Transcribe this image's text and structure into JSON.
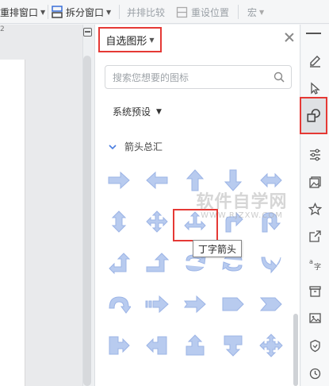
{
  "toolbar": {
    "rearrange_windows": "重排窗口",
    "split_window": "拆分窗口",
    "side_by_side": "并排比较",
    "reset_position": "重设位置",
    "macro": "宏"
  },
  "ruler": {
    "number": "2"
  },
  "panel": {
    "title": "自选图形",
    "search_placeholder": "搜索您想要的图标",
    "preset_label": "系统预设",
    "section_label": "箭头总汇",
    "tooltip": "丁字箭头"
  },
  "watermark": {
    "main": "软件自学网",
    "sub": "WWW.RJZXW.COM"
  },
  "colors": {
    "shape_fill": "#b8cbef",
    "shape_stroke": "#9cb4e6",
    "highlight": "#e53935"
  },
  "shapes": [
    "right-arrow",
    "left-arrow",
    "up-arrow",
    "down-arrow",
    "left-right-arrow",
    "up-down-arrow",
    "quad-arrow",
    "left-right-up-arrow",
    "bent-arrow",
    "u-turn-arrow",
    "left-up-arrow",
    "bent-up-arrow",
    "curved-right-arrow",
    "curved-left-arrow",
    "curved-down-arrow",
    "curved-up-arrow",
    "striped-right-arrow",
    "notched-right-arrow",
    "pentagon",
    "chevron",
    "right-arrow-callout",
    "left-arrow-callout",
    "up-arrow-callout",
    "down-arrow-callout",
    "quad-arrow-callout"
  ],
  "sidebar_icons": [
    "pen-icon",
    "cursor-icon",
    "shapes-icon",
    "settings-sliders-icon",
    "image-gallery-icon",
    "star-icon",
    "share-icon",
    "translate-icon",
    "archive-icon",
    "picture-icon",
    "shield-icon",
    "history-icon"
  ]
}
